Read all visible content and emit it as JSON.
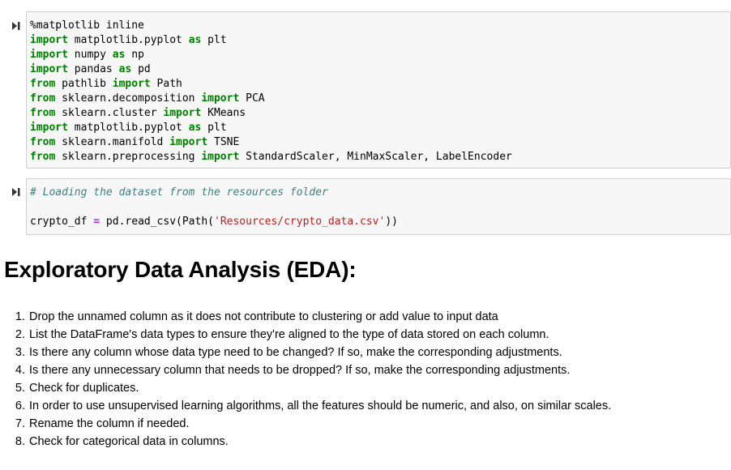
{
  "cell1": {
    "lines": [
      [
        {
          "t": "%matplotlib inline",
          "c": ""
        }
      ],
      [
        {
          "t": "import",
          "c": "kw"
        },
        {
          "t": " matplotlib.pyplot ",
          "c": ""
        },
        {
          "t": "as",
          "c": "kw"
        },
        {
          "t": " plt",
          "c": ""
        }
      ],
      [
        {
          "t": "import",
          "c": "kw"
        },
        {
          "t": " numpy ",
          "c": ""
        },
        {
          "t": "as",
          "c": "kw"
        },
        {
          "t": " np",
          "c": ""
        }
      ],
      [
        {
          "t": "import",
          "c": "kw"
        },
        {
          "t": " pandas ",
          "c": ""
        },
        {
          "t": "as",
          "c": "kw"
        },
        {
          "t": " pd",
          "c": ""
        }
      ],
      [
        {
          "t": "from",
          "c": "kw"
        },
        {
          "t": " pathlib ",
          "c": ""
        },
        {
          "t": "import",
          "c": "kw"
        },
        {
          "t": " Path",
          "c": ""
        }
      ],
      [
        {
          "t": "from",
          "c": "kw"
        },
        {
          "t": " sklearn.decomposition ",
          "c": ""
        },
        {
          "t": "import",
          "c": "kw"
        },
        {
          "t": " PCA",
          "c": ""
        }
      ],
      [
        {
          "t": "from",
          "c": "kw"
        },
        {
          "t": " sklearn.cluster ",
          "c": ""
        },
        {
          "t": "import",
          "c": "kw"
        },
        {
          "t": " KMeans",
          "c": ""
        }
      ],
      [
        {
          "t": "import",
          "c": "kw"
        },
        {
          "t": " matplotlib.pyplot ",
          "c": ""
        },
        {
          "t": "as",
          "c": "kw"
        },
        {
          "t": " plt",
          "c": ""
        }
      ],
      [
        {
          "t": "from",
          "c": "kw"
        },
        {
          "t": " sklearn.manifold ",
          "c": ""
        },
        {
          "t": "import",
          "c": "kw"
        },
        {
          "t": " TSNE",
          "c": ""
        }
      ],
      [
        {
          "t": "from",
          "c": "kw"
        },
        {
          "t": " sklearn.preprocessing ",
          "c": ""
        },
        {
          "t": "import",
          "c": "kw"
        },
        {
          "t": " StandardScaler, MinMaxScaler, LabelEncoder",
          "c": ""
        }
      ]
    ]
  },
  "cell2": {
    "lines": [
      [
        {
          "t": "# Loading the dataset from the resources folder",
          "c": "cm"
        }
      ],
      [
        {
          "t": "",
          "c": ""
        }
      ],
      [
        {
          "t": "crypto_df ",
          "c": ""
        },
        {
          "t": "=",
          "c": "op"
        },
        {
          "t": " pd.read_csv(Path(",
          "c": ""
        },
        {
          "t": "'Resources/crypto_data.csv'",
          "c": "st"
        },
        {
          "t": "))",
          "c": ""
        }
      ]
    ]
  },
  "heading": "Exploratory Data Analysis (EDA):",
  "steps": [
    "Drop the unnamed column as it does not contribute to clustering or add value to input data",
    "List the DataFrame's data types to ensure they're aligned to the type of data stored on each column.",
    "Is there any column whose data type need to be changed? If so, make the corresponding adjustments.",
    "Is there any unnecessary column that needs to be dropped? If so, make the corresponding adjustments.",
    "Check for duplicates.",
    "In order to use unsupervised learning algorithms, all the features should be numeric, and also, on similar scales.",
    "Rename the column if needed.",
    "Check for categorical data in columns."
  ]
}
